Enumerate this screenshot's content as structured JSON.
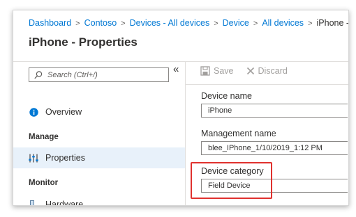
{
  "breadcrumb": {
    "items": [
      "Dashboard",
      "Contoso",
      "Devices - All devices",
      "Device",
      "All devices"
    ],
    "current": "iPhone -",
    "separator": ">"
  },
  "page": {
    "title": "iPhone - Properties"
  },
  "sidebar": {
    "search_placeholder": "Search (Ctrl+/)",
    "collapse_glyph": "«",
    "overview_label": "Overview",
    "manage_header": "Manage",
    "properties_label": "Properties",
    "monitor_header": "Monitor",
    "hardware_label": "Hardware"
  },
  "toolbar": {
    "save_label": "Save",
    "discard_label": "Discard"
  },
  "form": {
    "device_name_label": "Device name",
    "device_name_value": "iPhone",
    "management_name_label": "Management name",
    "management_name_value": "blee_IPhone_1/10/2019_1:12 PM",
    "device_category_label": "Device category",
    "device_category_value": "Field Device"
  },
  "colors": {
    "link": "#0078d4",
    "selected_bg": "#e8f1fa",
    "highlight": "#e0312e",
    "info_icon": "#0078d4"
  }
}
